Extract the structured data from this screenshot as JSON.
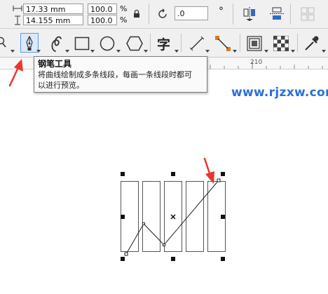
{
  "property_bar": {
    "width_value": "17.33 mm",
    "height_value": "14.155 mm",
    "scale_x": "100.0",
    "scale_y": "100.0",
    "percent_symbol": "%",
    "rotation_value": ".0",
    "degree_symbol": "°"
  },
  "toolbar": {
    "text_tool_glyph": "字"
  },
  "tooltip": {
    "title": "钢笔工具",
    "line1": "将曲线绘制成多条线段，每画一条线段时都可",
    "line2": "以进行预览。"
  },
  "ruler": {
    "label": "210"
  },
  "watermark": {
    "text": "www.rjzxw.com"
  },
  "colors": {
    "accent": "#5b9bd5",
    "arrow_red": "#e8362f",
    "watermark_blue": "#2b6fd6"
  }
}
